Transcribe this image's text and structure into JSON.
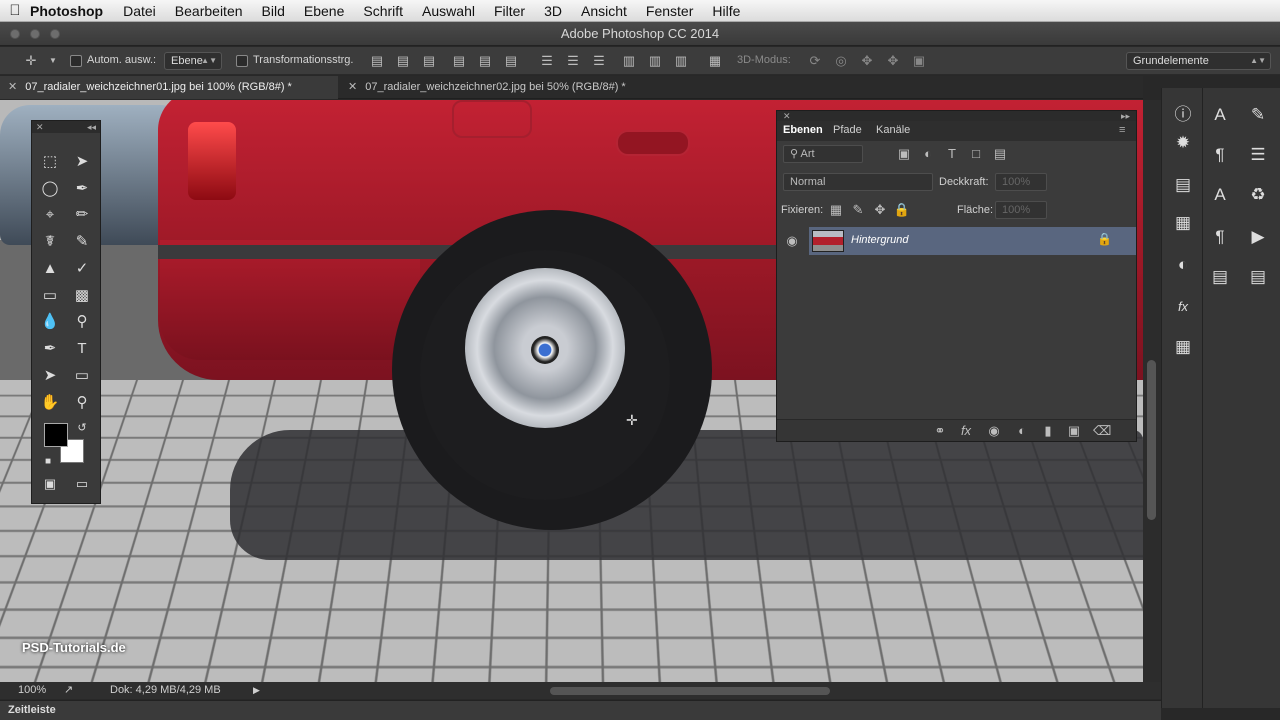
{
  "menubar": {
    "app": "Photoshop",
    "items": [
      "Datei",
      "Bearbeiten",
      "Bild",
      "Ebene",
      "Schrift",
      "Auswahl",
      "Filter",
      "3D",
      "Ansicht",
      "Fenster",
      "Hilfe"
    ]
  },
  "window": {
    "title": "Adobe Photoshop CC 2014"
  },
  "options": {
    "auto_select_label": "Autom. ausw.:",
    "auto_select_value": "Ebene",
    "transform_label": "Transformationsstrg.",
    "mode3d_label": "3D-Modus:",
    "workspace": "Grundelemente"
  },
  "tabs": [
    {
      "label": "07_radialer_weichzeichner01.jpg bei 100% (RGB/8#) *"
    },
    {
      "label": "07_radialer_weichzeichner02.jpg bei 50% (RGB/8#) *"
    }
  ],
  "layers_panel": {
    "tabs": [
      "Ebenen",
      "Pfade",
      "Kanäle"
    ],
    "filter": "Art",
    "blend_mode": "Normal",
    "opacity_label": "Deckkraft:",
    "opacity_value": "100%",
    "lock_label": "Fixieren:",
    "fill_label": "Fläche:",
    "fill_value": "100%",
    "layer_name": "Hintergrund"
  },
  "status": {
    "zoom": "100%",
    "doc": "Dok: 4,29 MB/4,29 MB"
  },
  "timeline": "Zeitleiste",
  "watermark": "PSD-Tutorials.de"
}
